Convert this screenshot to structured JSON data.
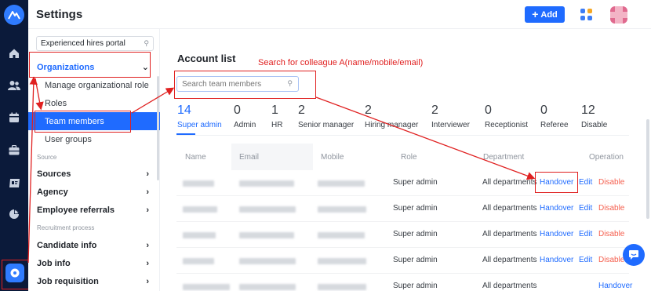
{
  "header": {
    "title": "Settings",
    "add_label": "Add"
  },
  "sidebar": {
    "search_value": "Experienced hires portal",
    "items": [
      {
        "label": "Organizations"
      },
      {
        "label": "Manage organizational role"
      },
      {
        "label": "Roles"
      },
      {
        "label": "Team members"
      },
      {
        "label": "User groups"
      },
      {
        "label": "Source"
      },
      {
        "label": "Sources"
      },
      {
        "label": "Agency"
      },
      {
        "label": "Employee referrals"
      },
      {
        "label": "Recruitment process"
      },
      {
        "label": "Candidate info"
      },
      {
        "label": "Job info"
      },
      {
        "label": "Job requisition"
      }
    ]
  },
  "main": {
    "title": "Account list",
    "annotation": "Search for colleague A(name/mobile/email)",
    "search_placeholder": "Search team members",
    "stats": [
      {
        "count": "14",
        "label": "Super admin"
      },
      {
        "count": "0",
        "label": "Admin"
      },
      {
        "count": "1",
        "label": "HR"
      },
      {
        "count": "2",
        "label": "Senior manager"
      },
      {
        "count": "2",
        "label": "Hiring manager"
      },
      {
        "count": "2",
        "label": "Interviewer"
      },
      {
        "count": "0",
        "label": "Receptionist"
      },
      {
        "count": "0",
        "label": "Referee"
      },
      {
        "count": "12",
        "label": "Disable"
      }
    ],
    "columns": [
      "Name",
      "Email",
      "Mobile",
      "Role",
      "Department",
      "Operation"
    ],
    "rows": [
      {
        "role": "Super admin",
        "department": "All departments",
        "handover": "Handover",
        "edit": "Edit",
        "disable": "Disable"
      },
      {
        "role": "Super admin",
        "department": "All departments",
        "handover": "Handover",
        "edit": "Edit",
        "disable": "Disable"
      },
      {
        "role": "Super admin",
        "department": "All departments",
        "handover": "Handover",
        "edit": "Edit",
        "disable": "Disable"
      },
      {
        "role": "Super admin",
        "department": "All departments",
        "handover": "Handover",
        "edit": "Edit",
        "disable": "Disable"
      },
      {
        "role": "Super admin",
        "department": "All departments",
        "handover": "Handover",
        "edit": "",
        "disable": ""
      }
    ]
  },
  "icons": {
    "rail": [
      "logo-icon",
      "home-icon",
      "people-icon",
      "calendar-icon",
      "briefcase-icon",
      "id-card-icon",
      "pie-chart-icon",
      "settings-icon"
    ],
    "header": [
      "plus-icon",
      "apps-icon",
      "avatar"
    ],
    "other": [
      "search-icon",
      "chevron-down-icon",
      "chevron-right-icon",
      "chat-icon"
    ]
  },
  "colors": {
    "accent": "#1f6bff",
    "rail": "#0b1a3a",
    "annotation": "#e02020",
    "danger": "#f5604f"
  }
}
